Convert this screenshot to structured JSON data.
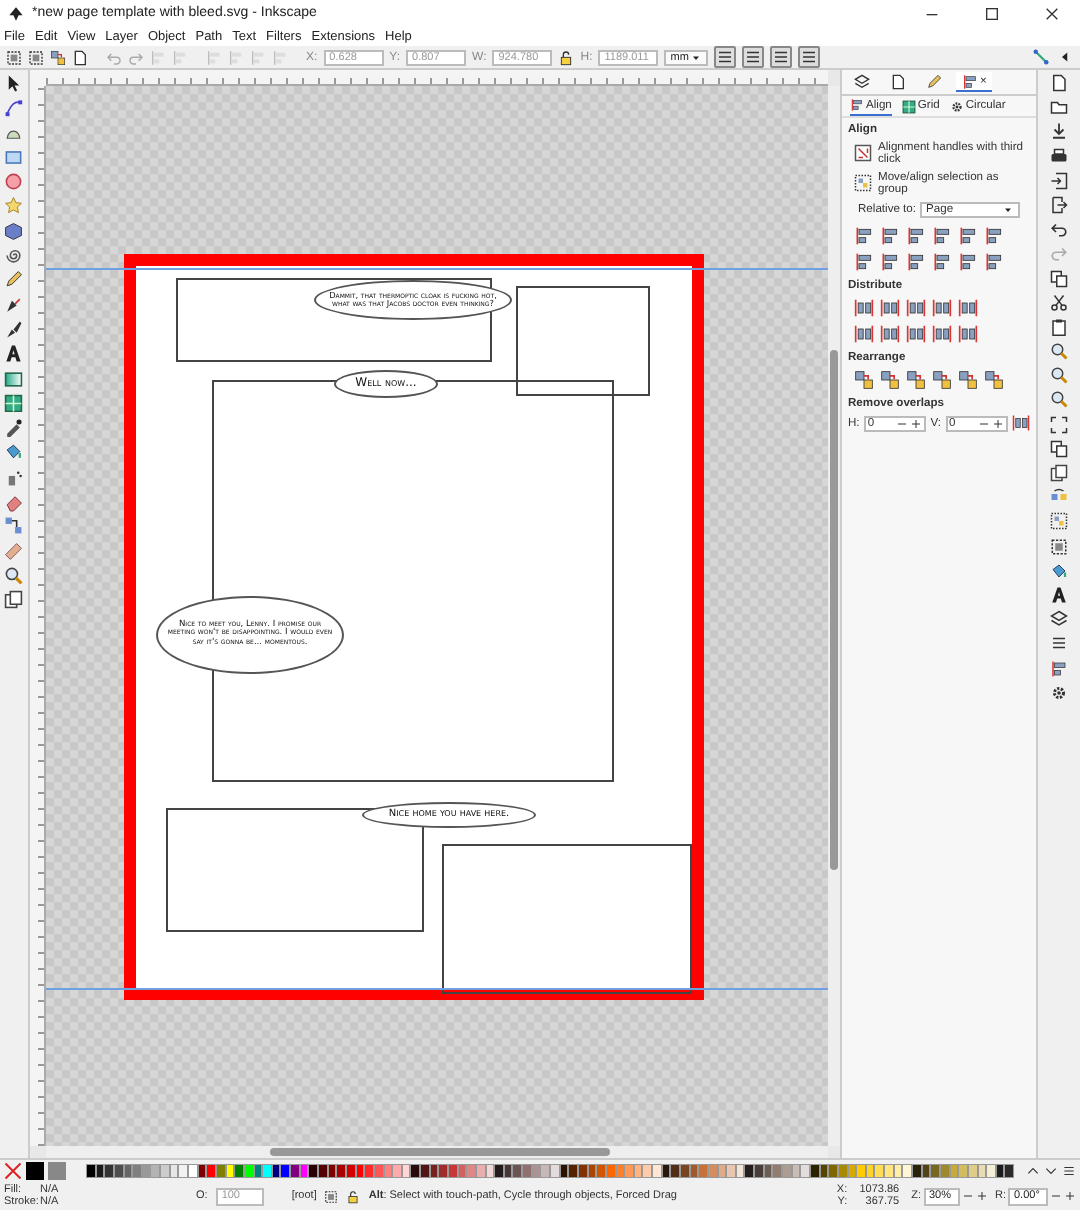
{
  "window": {
    "title": "*new page template with bleed.svg - Inkscape"
  },
  "menu": [
    "File",
    "Edit",
    "View",
    "Layer",
    "Object",
    "Path",
    "Text",
    "Filters",
    "Extensions",
    "Help"
  ],
  "toolbar": {
    "fields": [
      {
        "label": "X:",
        "value": "0.628",
        "disabled": true
      },
      {
        "label": "Y:",
        "value": "0.807",
        "disabled": true
      },
      {
        "label": "W:",
        "value": "924.780",
        "disabled": true
      },
      {
        "label": "H:",
        "value": "1189.011",
        "disabled": true
      }
    ],
    "unit": "mm"
  },
  "canvas": {
    "bubbles": [
      {
        "text": "Dammit, that thermoptic cloak is fucking hot, what was that Jacobs doctor even thinking?"
      },
      {
        "text": "Well now..."
      },
      {
        "text": "Nice to meet you, Lenny. I promise our meeting won't be disappointing. I would even say it's gonna be... momentous."
      },
      {
        "text": "Nice home you have here."
      }
    ]
  },
  "align_panel": {
    "dock_tabs": [
      {
        "selected": false
      },
      {
        "selected": false
      },
      {
        "selected": false
      },
      {
        "selected": true,
        "close": "×"
      }
    ],
    "subtabs": [
      {
        "label": "Align",
        "selected": true
      },
      {
        "label": "Grid",
        "selected": false
      },
      {
        "label": "Circular",
        "selected": false
      }
    ],
    "heading": "Align",
    "options": [
      {
        "label": "Alignment handles with third click"
      },
      {
        "label": "Move/align selection as group"
      }
    ],
    "relative_to": {
      "label": "Relative to:",
      "value": "Page"
    },
    "sections": [
      "Distribute",
      "Rearrange",
      "Remove overlaps"
    ],
    "overlaps": [
      {
        "label": "H:",
        "value": "0"
      },
      {
        "label": "V:",
        "value": "0"
      }
    ]
  },
  "palette": [
    {
      "color": "#000000"
    },
    {
      "color": "#1a1a1a"
    },
    {
      "color": "#333333"
    },
    {
      "color": "#4d4d4d"
    },
    {
      "color": "#666666"
    },
    {
      "color": "#808080"
    },
    {
      "color": "#999999"
    },
    {
      "color": "#b3b3b3"
    },
    {
      "color": "#cccccc"
    },
    {
      "color": "#e6e6e6"
    },
    {
      "color": "#f2f2f2"
    },
    {
      "color": "#ffffff"
    },
    {
      "color": "#800000"
    },
    {
      "color": "#ff0000"
    },
    {
      "color": "#808000"
    },
    {
      "color": "#ffff00"
    },
    {
      "color": "#008000"
    },
    {
      "color": "#00ff00"
    },
    {
      "color": "#008080"
    },
    {
      "color": "#00ffff"
    },
    {
      "color": "#000080"
    },
    {
      "color": "#0000ff"
    },
    {
      "color": "#800080"
    },
    {
      "color": "#ff00ff"
    },
    {
      "color": "#2b0000"
    },
    {
      "color": "#550000"
    },
    {
      "color": "#800000"
    },
    {
      "color": "#aa0000"
    },
    {
      "color": "#d40000"
    },
    {
      "color": "#ff0000"
    },
    {
      "color": "#ff2a2a"
    },
    {
      "color": "#ff5555"
    },
    {
      "color": "#ff8080"
    },
    {
      "color": "#ffaaaa"
    },
    {
      "color": "#ffd5d5"
    },
    {
      "color": "#280b0b"
    },
    {
      "color": "#501616"
    },
    {
      "color": "#782121"
    },
    {
      "color": "#a02c2c"
    },
    {
      "color": "#c83737"
    },
    {
      "color": "#d35f5f"
    },
    {
      "color": "#de8787"
    },
    {
      "color": "#e9afaf"
    },
    {
      "color": "#f4d7d7"
    },
    {
      "color": "#241c1c"
    },
    {
      "color": "#483737"
    },
    {
      "color": "#6c5353"
    },
    {
      "color": "#916f6f"
    },
    {
      "color": "#ac9393"
    },
    {
      "color": "#c8b7b7"
    },
    {
      "color": "#e3dbdb"
    },
    {
      "color": "#2b1100"
    },
    {
      "color": "#552200"
    },
    {
      "color": "#803300"
    },
    {
      "color": "#aa4400"
    },
    {
      "color": "#d45500"
    },
    {
      "color": "#ff6600"
    },
    {
      "color": "#ff7f2a"
    },
    {
      "color": "#ff9955"
    },
    {
      "color": "#ffb380"
    },
    {
      "color": "#ffccaa"
    },
    {
      "color": "#ffe6d5"
    },
    {
      "color": "#28170b"
    },
    {
      "color": "#502d16"
    },
    {
      "color": "#784421"
    },
    {
      "color": "#a05a2c"
    },
    {
      "color": "#c87137"
    },
    {
      "color": "#d38d5f"
    },
    {
      "color": "#deaa87"
    },
    {
      "color": "#e9c6af"
    },
    {
      "color": "#f4e3d7"
    },
    {
      "color": "#241f1c"
    },
    {
      "color": "#483e37"
    },
    {
      "color": "#6c5d53"
    },
    {
      "color": "#917c6f"
    },
    {
      "color": "#ac9d93"
    },
    {
      "color": "#c8beb7"
    },
    {
      "color": "#e3dedb"
    },
    {
      "color": "#2b2200"
    },
    {
      "color": "#554400"
    },
    {
      "color": "#806600"
    },
    {
      "color": "#aa8800"
    },
    {
      "color": "#d4aa00"
    },
    {
      "color": "#ffcc00"
    },
    {
      "color": "#ffd42a"
    },
    {
      "color": "#ffdd55"
    },
    {
      "color": "#ffe680"
    },
    {
      "color": "#ffeeaa"
    },
    {
      "color": "#fff6d5"
    },
    {
      "color": "#28220b"
    },
    {
      "color": "#504416"
    },
    {
      "color": "#786721"
    },
    {
      "color": "#a0892c"
    },
    {
      "color": "#c8ab37"
    },
    {
      "color": "#d3bc5f"
    },
    {
      "color": "#decd87"
    },
    {
      "color": "#e9ddaf"
    },
    {
      "color": "#f4eed7"
    },
    {
      "color": "#1c1c1c"
    },
    {
      "color": "#2a2a2a"
    }
  ],
  "status": {
    "fill": {
      "label": "Fill:",
      "value": "N/A"
    },
    "stroke": {
      "label": "Stroke:",
      "value": "N/A"
    },
    "opacity": {
      "label": "O:",
      "value": "100",
      "disabled": true
    },
    "layer": "[root]",
    "message": "**Alt**: Select with touch-path, Cycle through objects, Forced Drag",
    "cursor": [
      {
        "label": "X:",
        "value": "1073.86"
      },
      {
        "label": "Y:",
        "value": "367.75"
      }
    ],
    "zoom": {
      "label": "Z:",
      "value": "30%"
    },
    "rotation": {
      "label": "R:",
      "value": "0.00°"
    }
  }
}
